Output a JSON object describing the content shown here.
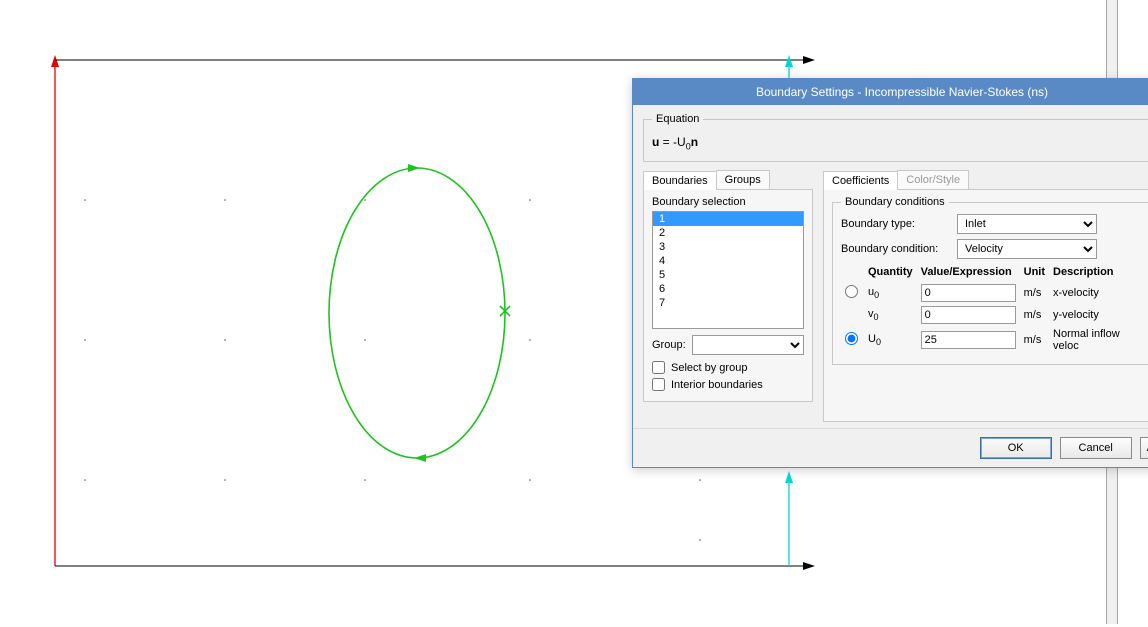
{
  "dialog": {
    "title": "Boundary Settings - Incompressible Navier-Stokes (ns)",
    "equation_legend": "Equation",
    "equation_html": "u = -U₀n",
    "left_tabs": {
      "boundaries": "Boundaries",
      "groups": "Groups"
    },
    "boundary_selection_label": "Boundary selection",
    "boundary_list": [
      "1",
      "2",
      "3",
      "4",
      "5",
      "6",
      "7"
    ],
    "selected_boundary": "1",
    "group_label": "Group:",
    "group_value": "",
    "select_by_group": "Select by group",
    "interior_boundaries": "Interior boundaries",
    "right_tabs": {
      "coefficients": "Coefficients",
      "colorstyle": "Color/Style"
    },
    "bcond_legend": "Boundary conditions",
    "boundary_type_label": "Boundary type:",
    "boundary_type_value": "Inlet",
    "boundary_condition_label": "Boundary condition:",
    "boundary_condition_value": "Velocity",
    "headers": {
      "quantity": "Quantity",
      "value": "Value/Expression",
      "unit": "Unit",
      "desc": "Description"
    },
    "rows": [
      {
        "radio": "u",
        "qty": "u₀",
        "value": "0",
        "unit": "m/s",
        "desc": "x-velocity"
      },
      {
        "radio": "",
        "qty": "v₀",
        "value": "0",
        "unit": "m/s",
        "desc": "y-velocity"
      },
      {
        "radio": "U",
        "qty": "U₀",
        "value": "25",
        "unit": "m/s",
        "desc": "Normal inflow veloc"
      }
    ],
    "radio_selected": "U",
    "buttons": {
      "ok": "OK",
      "cancel": "Cancel",
      "apply": "A"
    }
  }
}
